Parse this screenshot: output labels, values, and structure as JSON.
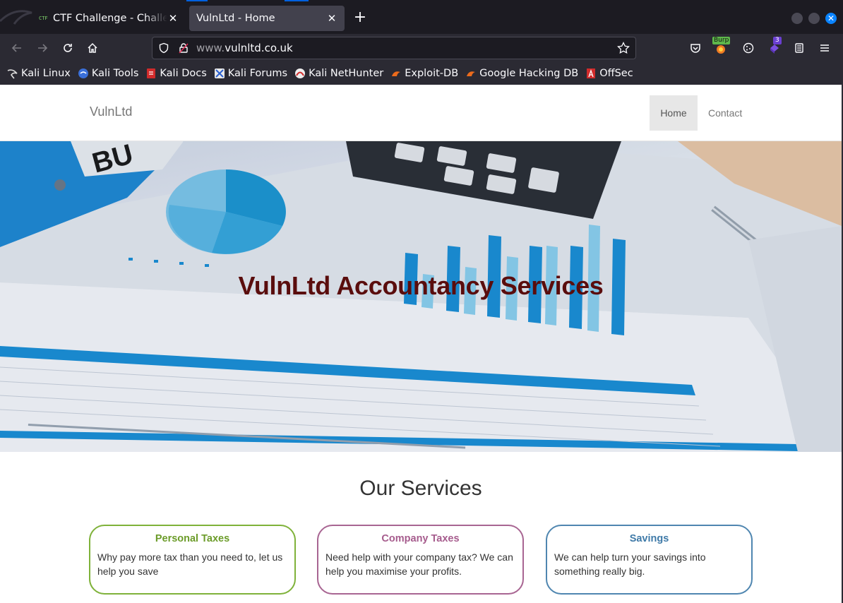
{
  "browser": {
    "tabs": [
      {
        "title": "CTF Challenge - Challenge",
        "active": false,
        "favicon": "ctf-favicon"
      },
      {
        "title": "VulnLtd - Home",
        "active": true,
        "favicon": "none"
      }
    ],
    "url": {
      "prefix": "www.",
      "domain": "vulnltd.co.uk"
    },
    "toolbar_icons": [
      "pocket-icon",
      "burp-extension-icon",
      "cookie-icon",
      "extension-icon",
      "reader-icon",
      "menu-icon"
    ],
    "burp_badge": "Burp",
    "extension_badge": "3",
    "bookmarks": [
      {
        "label": "Kali Linux",
        "icon": "kali-dragon-icon"
      },
      {
        "label": "Kali Tools",
        "icon": "kali-tools-icon"
      },
      {
        "label": "Kali Docs",
        "icon": "kali-docs-icon"
      },
      {
        "label": "Kali Forums",
        "icon": "kali-forums-icon"
      },
      {
        "label": "Kali NetHunter",
        "icon": "nethunter-icon"
      },
      {
        "label": "Exploit-DB",
        "icon": "exploit-db-icon"
      },
      {
        "label": "Google Hacking DB",
        "icon": "ghdb-icon"
      },
      {
        "label": "OffSec",
        "icon": "offsec-icon"
      }
    ]
  },
  "site": {
    "brand": "VulnLtd",
    "nav": [
      {
        "label": "Home",
        "active": true
      },
      {
        "label": "Contact",
        "active": false
      }
    ],
    "hero_title": "VulnLtd Accountancy Services",
    "services_title": "Our Services",
    "services": [
      {
        "title": "Personal Taxes",
        "text": "Why pay more tax than you need to, let us help you save",
        "color": "#7fb23a"
      },
      {
        "title": "Company Taxes",
        "text": "Need help with your company tax? We can help you maximise your profits.",
        "color": "#a86592"
      },
      {
        "title": "Savings",
        "text": "We can help turn your savings into something really big.",
        "color": "#4f86b0"
      }
    ]
  },
  "colors": {
    "browser_bg": "#1c1b22",
    "toolbar_bg": "#2b2a33",
    "active_tab": "#42414d",
    "hero_title": "#5a0d0d"
  }
}
